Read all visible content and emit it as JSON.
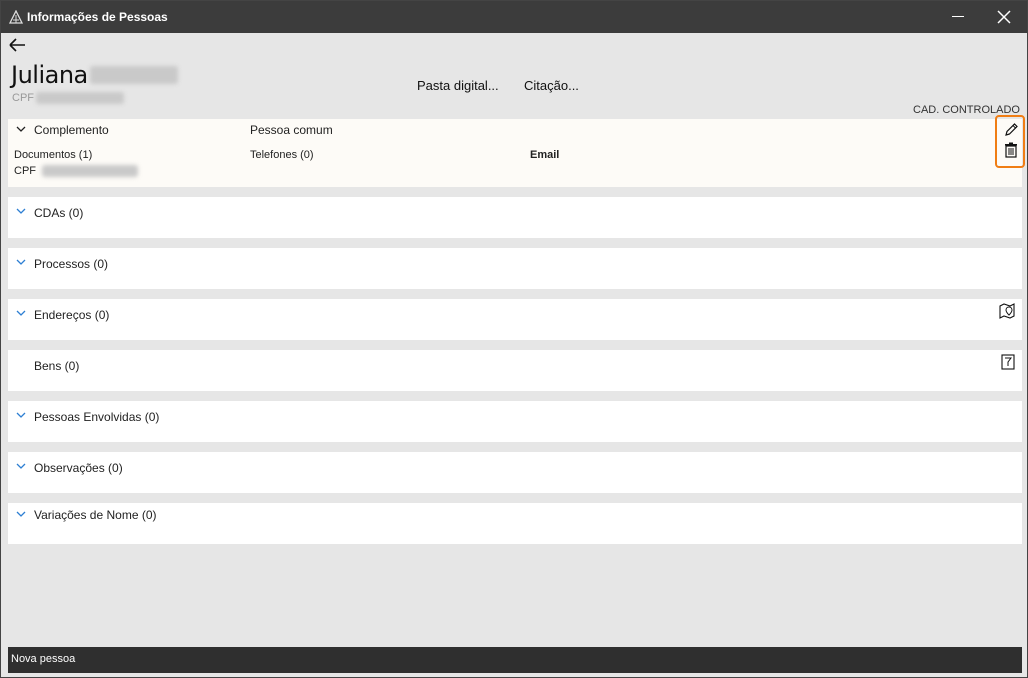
{
  "window": {
    "title": "Informações de Pessoas"
  },
  "header": {
    "first_name": "Juliana",
    "cpf_label": "CPF",
    "links": {
      "pasta_digital": "Pasta digital...",
      "citacao": "Citação..."
    },
    "cad_status": "CAD. CONTROLADO"
  },
  "complemento": {
    "label": "Complemento",
    "person_type": "Pessoa comum",
    "documentos": "Documentos (1)",
    "telefones": "Telefones (0)",
    "email": "Email",
    "cpf_label": "CPF"
  },
  "sections": {
    "cdas": "CDAs (0)",
    "processos": "Processos (0)",
    "enderecos": "Endereços (0)",
    "bens": "Bens (0)",
    "pessoas_envolvidas": "Pessoas Envolvidas (0)",
    "observacoes": "Observações (0)",
    "variacoes_nome": "Variações de Nome (0)"
  },
  "statusbar": {
    "text": "Nova pessoa"
  },
  "colors": {
    "accent": "#f07d14",
    "chevron": "#2d7fd3",
    "titlebar": "#3c3c3c",
    "background": "#e6e6e6"
  }
}
